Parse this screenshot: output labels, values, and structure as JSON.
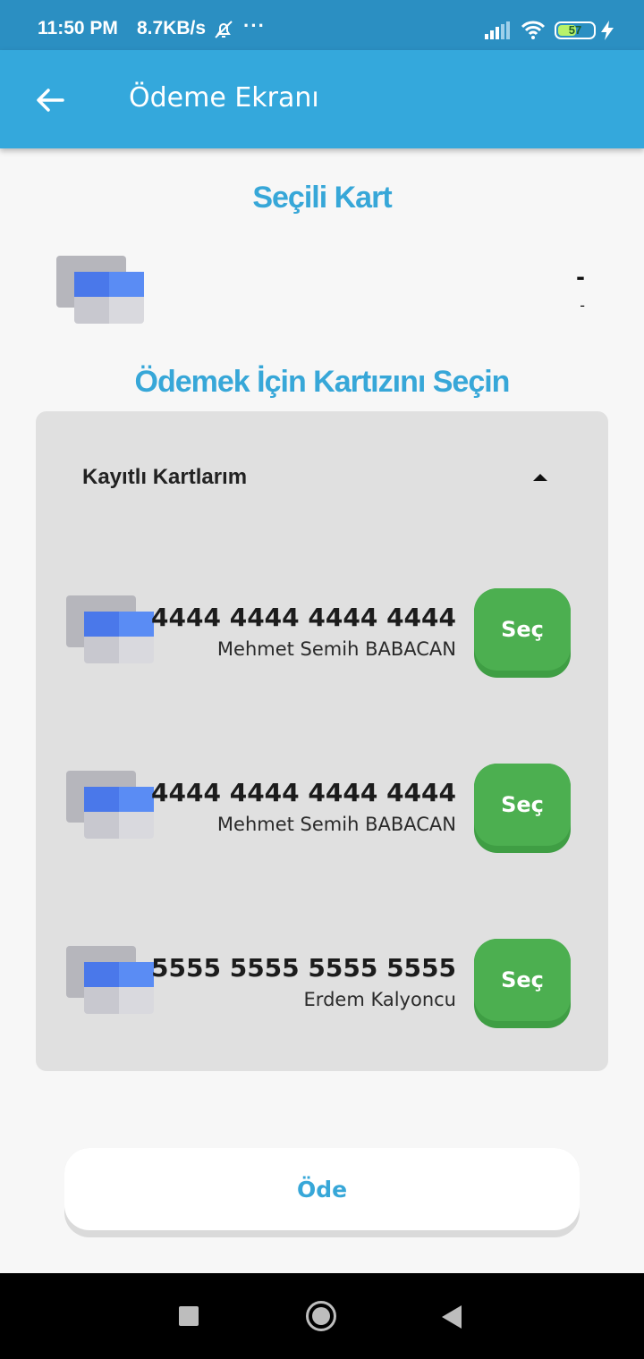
{
  "status_bar": {
    "time": "11:50 PM",
    "net_speed": "8.7KB/s",
    "overflow_dots": "···",
    "battery_level": "57",
    "icons": [
      "bell-off-icon",
      "signal-icon",
      "wifi-icon",
      "battery-icon",
      "charging-icon"
    ]
  },
  "app_bar": {
    "title": "Ödeme Ekranı",
    "back_icon": "arrow-left-icon",
    "color": "#34a8dc"
  },
  "selected_card": {
    "heading": "Seçili Kart",
    "number": "-",
    "holder": "-"
  },
  "select_prompt": "Ödemek İçin Kartızını Seçin",
  "saved_cards": {
    "header": "Kayıtlı Kartlarım",
    "expanded": true,
    "items": [
      {
        "number": "4444 4444 4444 4444",
        "holder": "Mehmet Semih BABACAN",
        "button": "Seç"
      },
      {
        "number": "4444 4444 4444 4444",
        "holder": "Mehmet Semih BABACAN",
        "button": "Seç"
      },
      {
        "number": "5555 5555 5555 5555",
        "holder": "Erdem Kalyoncu",
        "button": "Seç"
      }
    ]
  },
  "pay_button": "Öde",
  "colors": {
    "accent": "#37a7d8",
    "select_button": "#4caf50"
  }
}
